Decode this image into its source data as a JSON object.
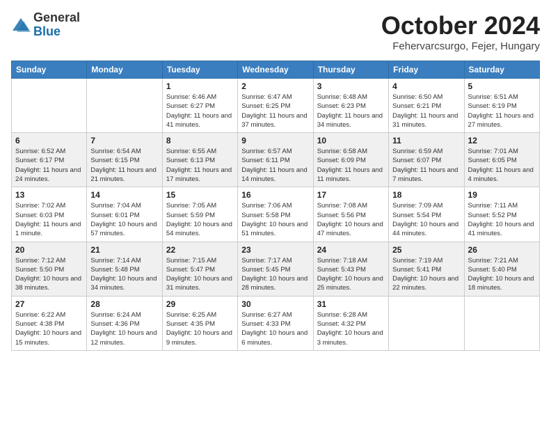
{
  "logo": {
    "general": "General",
    "blue": "Blue"
  },
  "header": {
    "month": "October 2024",
    "location": "Fehervarcsurgo, Fejer, Hungary"
  },
  "weekdays": [
    "Sunday",
    "Monday",
    "Tuesday",
    "Wednesday",
    "Thursday",
    "Friday",
    "Saturday"
  ],
  "weeks": [
    [
      {
        "day": "",
        "info": ""
      },
      {
        "day": "",
        "info": ""
      },
      {
        "day": "1",
        "info": "Sunrise: 6:46 AM\nSunset: 6:27 PM\nDaylight: 11 hours and 41 minutes."
      },
      {
        "day": "2",
        "info": "Sunrise: 6:47 AM\nSunset: 6:25 PM\nDaylight: 11 hours and 37 minutes."
      },
      {
        "day": "3",
        "info": "Sunrise: 6:48 AM\nSunset: 6:23 PM\nDaylight: 11 hours and 34 minutes."
      },
      {
        "day": "4",
        "info": "Sunrise: 6:50 AM\nSunset: 6:21 PM\nDaylight: 11 hours and 31 minutes."
      },
      {
        "day": "5",
        "info": "Sunrise: 6:51 AM\nSunset: 6:19 PM\nDaylight: 11 hours and 27 minutes."
      }
    ],
    [
      {
        "day": "6",
        "info": "Sunrise: 6:52 AM\nSunset: 6:17 PM\nDaylight: 11 hours and 24 minutes."
      },
      {
        "day": "7",
        "info": "Sunrise: 6:54 AM\nSunset: 6:15 PM\nDaylight: 11 hours and 21 minutes."
      },
      {
        "day": "8",
        "info": "Sunrise: 6:55 AM\nSunset: 6:13 PM\nDaylight: 11 hours and 17 minutes."
      },
      {
        "day": "9",
        "info": "Sunrise: 6:57 AM\nSunset: 6:11 PM\nDaylight: 11 hours and 14 minutes."
      },
      {
        "day": "10",
        "info": "Sunrise: 6:58 AM\nSunset: 6:09 PM\nDaylight: 11 hours and 11 minutes."
      },
      {
        "day": "11",
        "info": "Sunrise: 6:59 AM\nSunset: 6:07 PM\nDaylight: 11 hours and 7 minutes."
      },
      {
        "day": "12",
        "info": "Sunrise: 7:01 AM\nSunset: 6:05 PM\nDaylight: 11 hours and 4 minutes."
      }
    ],
    [
      {
        "day": "13",
        "info": "Sunrise: 7:02 AM\nSunset: 6:03 PM\nDaylight: 11 hours and 1 minute."
      },
      {
        "day": "14",
        "info": "Sunrise: 7:04 AM\nSunset: 6:01 PM\nDaylight: 10 hours and 57 minutes."
      },
      {
        "day": "15",
        "info": "Sunrise: 7:05 AM\nSunset: 5:59 PM\nDaylight: 10 hours and 54 minutes."
      },
      {
        "day": "16",
        "info": "Sunrise: 7:06 AM\nSunset: 5:58 PM\nDaylight: 10 hours and 51 minutes."
      },
      {
        "day": "17",
        "info": "Sunrise: 7:08 AM\nSunset: 5:56 PM\nDaylight: 10 hours and 47 minutes."
      },
      {
        "day": "18",
        "info": "Sunrise: 7:09 AM\nSunset: 5:54 PM\nDaylight: 10 hours and 44 minutes."
      },
      {
        "day": "19",
        "info": "Sunrise: 7:11 AM\nSunset: 5:52 PM\nDaylight: 10 hours and 41 minutes."
      }
    ],
    [
      {
        "day": "20",
        "info": "Sunrise: 7:12 AM\nSunset: 5:50 PM\nDaylight: 10 hours and 38 minutes."
      },
      {
        "day": "21",
        "info": "Sunrise: 7:14 AM\nSunset: 5:48 PM\nDaylight: 10 hours and 34 minutes."
      },
      {
        "day": "22",
        "info": "Sunrise: 7:15 AM\nSunset: 5:47 PM\nDaylight: 10 hours and 31 minutes."
      },
      {
        "day": "23",
        "info": "Sunrise: 7:17 AM\nSunset: 5:45 PM\nDaylight: 10 hours and 28 minutes."
      },
      {
        "day": "24",
        "info": "Sunrise: 7:18 AM\nSunset: 5:43 PM\nDaylight: 10 hours and 25 minutes."
      },
      {
        "day": "25",
        "info": "Sunrise: 7:19 AM\nSunset: 5:41 PM\nDaylight: 10 hours and 22 minutes."
      },
      {
        "day": "26",
        "info": "Sunrise: 7:21 AM\nSunset: 5:40 PM\nDaylight: 10 hours and 18 minutes."
      }
    ],
    [
      {
        "day": "27",
        "info": "Sunrise: 6:22 AM\nSunset: 4:38 PM\nDaylight: 10 hours and 15 minutes."
      },
      {
        "day": "28",
        "info": "Sunrise: 6:24 AM\nSunset: 4:36 PM\nDaylight: 10 hours and 12 minutes."
      },
      {
        "day": "29",
        "info": "Sunrise: 6:25 AM\nSunset: 4:35 PM\nDaylight: 10 hours and 9 minutes."
      },
      {
        "day": "30",
        "info": "Sunrise: 6:27 AM\nSunset: 4:33 PM\nDaylight: 10 hours and 6 minutes."
      },
      {
        "day": "31",
        "info": "Sunrise: 6:28 AM\nSunset: 4:32 PM\nDaylight: 10 hours and 3 minutes."
      },
      {
        "day": "",
        "info": ""
      },
      {
        "day": "",
        "info": ""
      }
    ]
  ]
}
